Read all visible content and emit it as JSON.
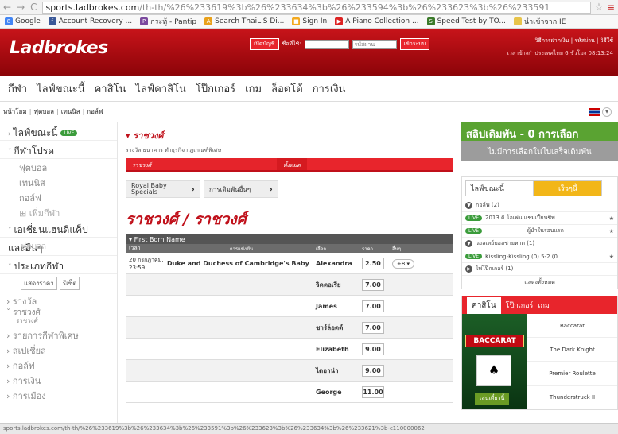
{
  "browser": {
    "url_domain": "sports.ladbrokes.com",
    "url_path": "/th-th/%26%233619%3b%26%233634%3b%26%233594%3b%26%233623%3b%26%233591",
    "bookmarks": [
      "Google",
      "Account Recovery ...",
      "กระทู้ - Pantip",
      "Search ThaiLIS Di...",
      "Sign In",
      "A Piano Collection ...",
      "Speed Test by TO...",
      "นำเข้าจาก IE"
    ]
  },
  "header": {
    "logo": "Ladbrokes",
    "open_account": "เปิดบัญชี",
    "username_label": "ชื่อที่ใช้:",
    "password_placeholder": "รหัสผ่าน",
    "login": "เข้าระบบ",
    "links": "วิธีการฝากเงิน | รหัสผ่าน | วิธีใช้",
    "time": "เวลาข้างกำประเทศไทย 6 ชั่วโมง 08:13:24"
  },
  "mainnav": [
    "กีฬา",
    "ไลฟ์ขณะนี้",
    "คาสิโน",
    "ไลฟ์คาสิโน",
    "โป๊กเกอร์",
    "เกม",
    "ล็อตโต้",
    "การเงิน"
  ],
  "subnav": [
    "หน้าโฮม",
    "ฟุตบอล",
    "เทนนิส",
    "กอล์ฟ"
  ],
  "left": {
    "live_now": "ไลฟ์ขณะนี้",
    "live_badge": "LIVE",
    "popular": "กีฬาโปรด",
    "popular_items": [
      "ฟุตบอล",
      "เทนนิส",
      "กอล์ฟ"
    ],
    "add_sport": "เพิ่มกีฬา",
    "asian": "เอเชี่ยนแฮนดิแค็ป",
    "all_sports": "และอื่นๆ",
    "overlay": "ฟุตบอล",
    "sport_type": "ประเภทกีฬา",
    "show_price": "แสดงราคา",
    "yearly": "รีเซ็ต",
    "items": [
      "รางวัล",
      "ราชวงศ์",
      "รายการกีฬาพิเศษ",
      "สเปเชี่ยล",
      "กอล์ฟ",
      "การเงิน",
      "การเมือง"
    ],
    "royal_sub": "ราชวงศ์"
  },
  "content": {
    "crumb": "ราชวงศ์",
    "links": "รางวัล  ธนาคาร  ทำธุรกิจ  กฎเกณฑ์พิเศษ",
    "tab1": "ราชวงศ์",
    "tab2": "ทั้งหมด",
    "box1": "Royal Baby Specials",
    "box2": "การเดิมพันอื่นๆ",
    "title": "ราชวงศ์ / ราชวงศ์",
    "market": "First Born Name",
    "cols": [
      "เวลา",
      "การแข่งขัน",
      "เลือก",
      "ราคา",
      "อื่นๆ"
    ],
    "date": "20 กรกฎาคม. 23:59",
    "event": "Duke and Duchess of Cambridge's Baby",
    "more": "+8",
    "selections": [
      {
        "name": "Alexandra",
        "price": "2.50"
      },
      {
        "name": "วิคตอเรีย",
        "price": "7.00"
      },
      {
        "name": "James",
        "price": "7.00"
      },
      {
        "name": "ชาร์ล็อตต์",
        "price": "7.00"
      },
      {
        "name": "Elizabeth",
        "price": "9.00"
      },
      {
        "name": "ไดอาน่า",
        "price": "9.00"
      },
      {
        "name": "George",
        "price": "11.00"
      }
    ]
  },
  "right": {
    "slip_title": "สลิปเดิมพัน - 0 การเลือก",
    "slip_empty": "ไม่มีการเลือกในใบเสร็จเดิมพัน",
    "inplay_tab": "ไลฟ์ขณะนี้",
    "upcoming_tab": "เร็วๆนี้",
    "golf": "กอล์ฟ (2)",
    "golf_item": "2013 ดิ โอเพ่น แชมเปี้ยนชิพ",
    "golf_item2": "ผู้นำในรอบแรก",
    "volleyball": "วอลเลย์บอลชายหาด (1)",
    "volley_item": "Kissling-Kissling (0) 5-2 (0...",
    "darts": "ไพ่โป๊กเกอร์ (1)",
    "show_all": "แสดงทั้งหมด",
    "casino_tabs": [
      "คาสิโน",
      "โป๊กเกอร์",
      "เกม"
    ],
    "casino_banner": "BACCARAT",
    "play_now": "เล่นเดี๋ยวนี้",
    "games": [
      "Baccarat",
      "The Dark Knight",
      "Premier Roulette",
      "Thunderstruck II"
    ]
  },
  "status_url": "sports.ladbrokes.com/th-th/%26%233619%3b%26%233634%3b%26%233591%3b%26%233623%3b%26%233634%3b%26%233621%3b-c110000062"
}
